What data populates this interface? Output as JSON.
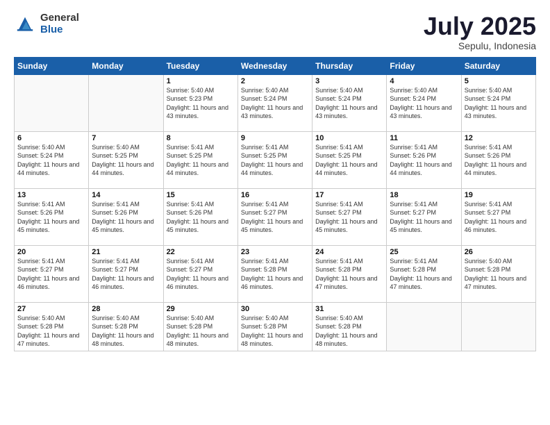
{
  "header": {
    "logo_general": "General",
    "logo_blue": "Blue",
    "month": "July 2025",
    "location": "Sepulu, Indonesia"
  },
  "weekdays": [
    "Sunday",
    "Monday",
    "Tuesday",
    "Wednesday",
    "Thursday",
    "Friday",
    "Saturday"
  ],
  "weeks": [
    [
      {
        "day": "",
        "info": ""
      },
      {
        "day": "",
        "info": ""
      },
      {
        "day": "1",
        "info": "Sunrise: 5:40 AM\nSunset: 5:23 PM\nDaylight: 11 hours and 43 minutes."
      },
      {
        "day": "2",
        "info": "Sunrise: 5:40 AM\nSunset: 5:24 PM\nDaylight: 11 hours and 43 minutes."
      },
      {
        "day": "3",
        "info": "Sunrise: 5:40 AM\nSunset: 5:24 PM\nDaylight: 11 hours and 43 minutes."
      },
      {
        "day": "4",
        "info": "Sunrise: 5:40 AM\nSunset: 5:24 PM\nDaylight: 11 hours and 43 minutes."
      },
      {
        "day": "5",
        "info": "Sunrise: 5:40 AM\nSunset: 5:24 PM\nDaylight: 11 hours and 43 minutes."
      }
    ],
    [
      {
        "day": "6",
        "info": "Sunrise: 5:40 AM\nSunset: 5:24 PM\nDaylight: 11 hours and 44 minutes."
      },
      {
        "day": "7",
        "info": "Sunrise: 5:40 AM\nSunset: 5:25 PM\nDaylight: 11 hours and 44 minutes."
      },
      {
        "day": "8",
        "info": "Sunrise: 5:41 AM\nSunset: 5:25 PM\nDaylight: 11 hours and 44 minutes."
      },
      {
        "day": "9",
        "info": "Sunrise: 5:41 AM\nSunset: 5:25 PM\nDaylight: 11 hours and 44 minutes."
      },
      {
        "day": "10",
        "info": "Sunrise: 5:41 AM\nSunset: 5:25 PM\nDaylight: 11 hours and 44 minutes."
      },
      {
        "day": "11",
        "info": "Sunrise: 5:41 AM\nSunset: 5:26 PM\nDaylight: 11 hours and 44 minutes."
      },
      {
        "day": "12",
        "info": "Sunrise: 5:41 AM\nSunset: 5:26 PM\nDaylight: 11 hours and 44 minutes."
      }
    ],
    [
      {
        "day": "13",
        "info": "Sunrise: 5:41 AM\nSunset: 5:26 PM\nDaylight: 11 hours and 45 minutes."
      },
      {
        "day": "14",
        "info": "Sunrise: 5:41 AM\nSunset: 5:26 PM\nDaylight: 11 hours and 45 minutes."
      },
      {
        "day": "15",
        "info": "Sunrise: 5:41 AM\nSunset: 5:26 PM\nDaylight: 11 hours and 45 minutes."
      },
      {
        "day": "16",
        "info": "Sunrise: 5:41 AM\nSunset: 5:27 PM\nDaylight: 11 hours and 45 minutes."
      },
      {
        "day": "17",
        "info": "Sunrise: 5:41 AM\nSunset: 5:27 PM\nDaylight: 11 hours and 45 minutes."
      },
      {
        "day": "18",
        "info": "Sunrise: 5:41 AM\nSunset: 5:27 PM\nDaylight: 11 hours and 45 minutes."
      },
      {
        "day": "19",
        "info": "Sunrise: 5:41 AM\nSunset: 5:27 PM\nDaylight: 11 hours and 46 minutes."
      }
    ],
    [
      {
        "day": "20",
        "info": "Sunrise: 5:41 AM\nSunset: 5:27 PM\nDaylight: 11 hours and 46 minutes."
      },
      {
        "day": "21",
        "info": "Sunrise: 5:41 AM\nSunset: 5:27 PM\nDaylight: 11 hours and 46 minutes."
      },
      {
        "day": "22",
        "info": "Sunrise: 5:41 AM\nSunset: 5:27 PM\nDaylight: 11 hours and 46 minutes."
      },
      {
        "day": "23",
        "info": "Sunrise: 5:41 AM\nSunset: 5:28 PM\nDaylight: 11 hours and 46 minutes."
      },
      {
        "day": "24",
        "info": "Sunrise: 5:41 AM\nSunset: 5:28 PM\nDaylight: 11 hours and 47 minutes."
      },
      {
        "day": "25",
        "info": "Sunrise: 5:41 AM\nSunset: 5:28 PM\nDaylight: 11 hours and 47 minutes."
      },
      {
        "day": "26",
        "info": "Sunrise: 5:40 AM\nSunset: 5:28 PM\nDaylight: 11 hours and 47 minutes."
      }
    ],
    [
      {
        "day": "27",
        "info": "Sunrise: 5:40 AM\nSunset: 5:28 PM\nDaylight: 11 hours and 47 minutes."
      },
      {
        "day": "28",
        "info": "Sunrise: 5:40 AM\nSunset: 5:28 PM\nDaylight: 11 hours and 48 minutes."
      },
      {
        "day": "29",
        "info": "Sunrise: 5:40 AM\nSunset: 5:28 PM\nDaylight: 11 hours and 48 minutes."
      },
      {
        "day": "30",
        "info": "Sunrise: 5:40 AM\nSunset: 5:28 PM\nDaylight: 11 hours and 48 minutes."
      },
      {
        "day": "31",
        "info": "Sunrise: 5:40 AM\nSunset: 5:28 PM\nDaylight: 11 hours and 48 minutes."
      },
      {
        "day": "",
        "info": ""
      },
      {
        "day": "",
        "info": ""
      }
    ]
  ]
}
